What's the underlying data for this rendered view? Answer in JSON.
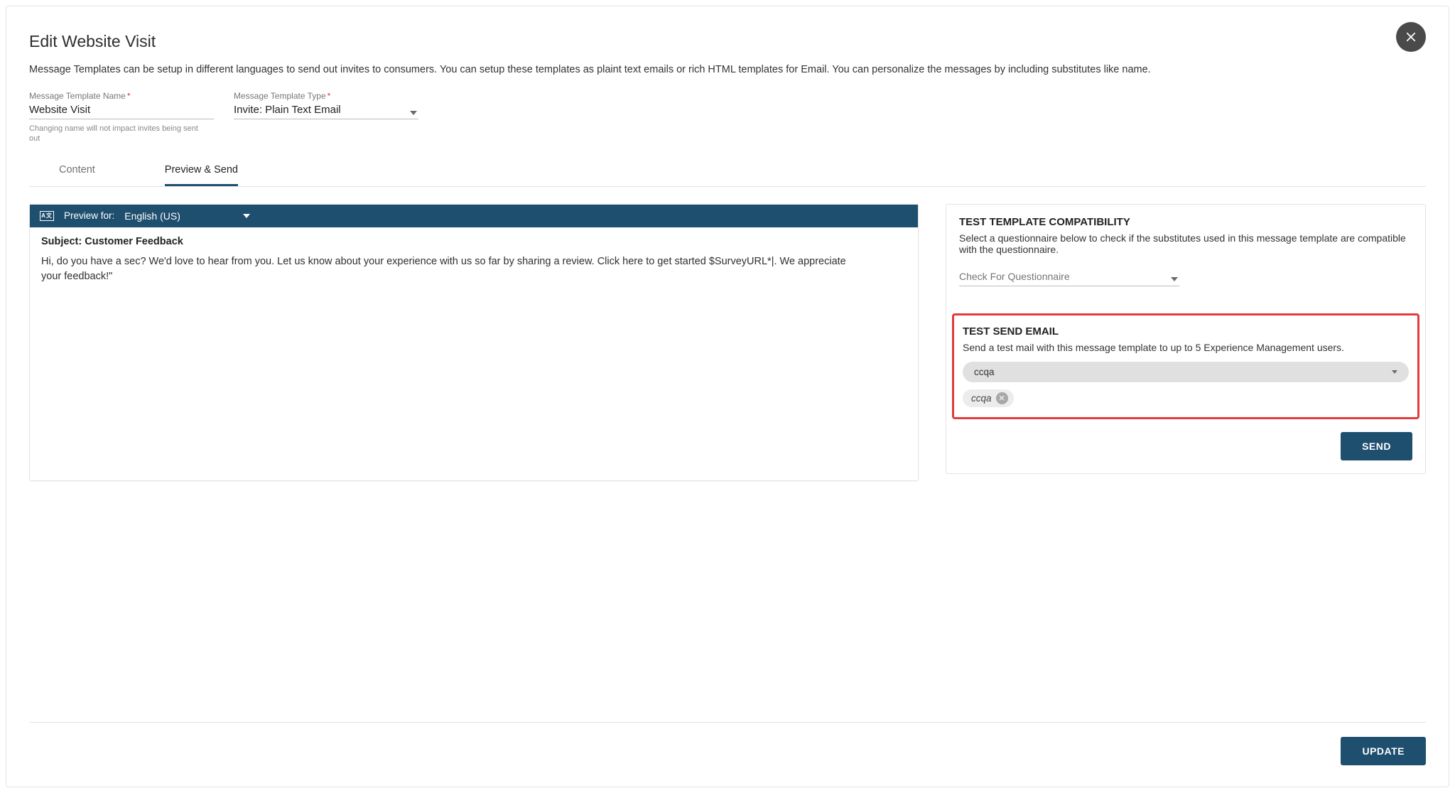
{
  "dialog": {
    "title": "Edit Website Visit",
    "intro": "Message Templates can be setup in different languages to send out invites to consumers. You can setup these templates as plaint text emails or rich HTML templates for Email. You can personalize the messages by including substitutes like name."
  },
  "fields": {
    "name_label": "Message Template Name",
    "name_value": "Website Visit",
    "name_hint": "Changing name will not impact invites being sent out",
    "type_label": "Message Template Type",
    "type_value": "Invite: Plain Text Email"
  },
  "tabs": {
    "content": "Content",
    "preview": "Preview & Send"
  },
  "preview": {
    "for_label": "Preview for:",
    "language": "English (US)",
    "subject_label": "Subject:",
    "subject_value": "Customer Feedback",
    "body": "Hi, do you have a sec? We'd love to hear from you. Let us know about your experience with us so far by sharing a review. Click here to get started $SurveyURL*|. We appreciate your feedback!\""
  },
  "compat": {
    "heading": "TEST TEMPLATE COMPATIBILITY",
    "desc": "Select a questionnaire below to check if the substitutes used in this message template are compatible with the questionnaire.",
    "placeholder": "Check For Questionnaire"
  },
  "test_send": {
    "heading": "TEST SEND EMAIL",
    "desc": "Send a test mail with this message template to up to 5 Experience Management users.",
    "user_select_value": "ccqa",
    "chip_value": "ccqa",
    "send_label": "SEND"
  },
  "footer": {
    "update_label": "UPDATE"
  }
}
